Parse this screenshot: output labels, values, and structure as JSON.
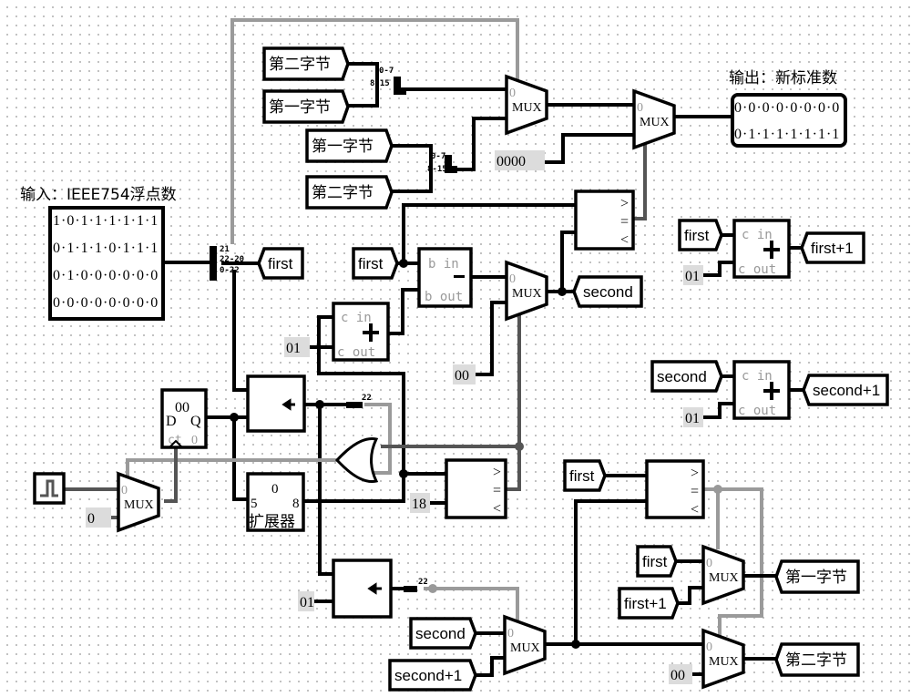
{
  "title_input": "输入：IEEE754浮点数",
  "title_output": "输出：新标准数",
  "input_bits": [
    "1·0·1·1·1·1·1·1",
    "0·1·1·1·0·1·1·1",
    "0·1·0·0·0·0·0·0",
    "0·0·0·0·0·0·0·0"
  ],
  "output_bits": [
    "0·0·0·0·0·0·0·0",
    "0·1·1·1·1·1·1·1"
  ],
  "splitter_main": {
    "labels": [
      "21",
      "22-20",
      "0-22"
    ]
  },
  "splitter_a": {
    "labels": [
      "0-7",
      "8-15"
    ]
  },
  "splitter_b": {
    "labels": [
      "0-7",
      "8-15"
    ]
  },
  "tunnels": {
    "byte2_a": "第二字节",
    "byte1_a": "第一字节",
    "byte1_b": "第一字节",
    "byte2_b": "第二字节",
    "first_main": "first",
    "first_sub": "first",
    "second_main": "second",
    "first_add": "first",
    "first_plus1_out": "first+1",
    "second_add": "second",
    "second_plus1_out": "second+1",
    "first_cmp": "first",
    "first_mux": "first",
    "first_plus1_mux": "first+1",
    "byte1_out": "第一字节",
    "byte2_out": "第二字节",
    "second_mux": "second",
    "second_plus1_mux": "second+1"
  },
  "constants": {
    "c0000": "0000",
    "c01_add": "01",
    "c00_mux": "00",
    "c01_first": "01",
    "c01_second": "01",
    "c0_clk": "0",
    "c18": "18",
    "c01_shift": "01",
    "c00_out": "00"
  },
  "components": {
    "mux_label": "MUX",
    "mux_sel0": "0",
    "adder_cin": "c in",
    "adder_cout": "c out",
    "sub_bin": "b in",
    "sub_bout": "b out",
    "cmp_gt": ">",
    "cmp_eq": "=",
    "cmp_lt": "<",
    "reg_value": "00",
    "reg_d": "D",
    "reg_q": "Q",
    "reg_ct": "ct",
    "reg_zero": "0",
    "ext_label": "扩展器",
    "ext_in": "5",
    "ext_out": "8",
    "ext_val": "0",
    "bitwidth_22": "22"
  }
}
